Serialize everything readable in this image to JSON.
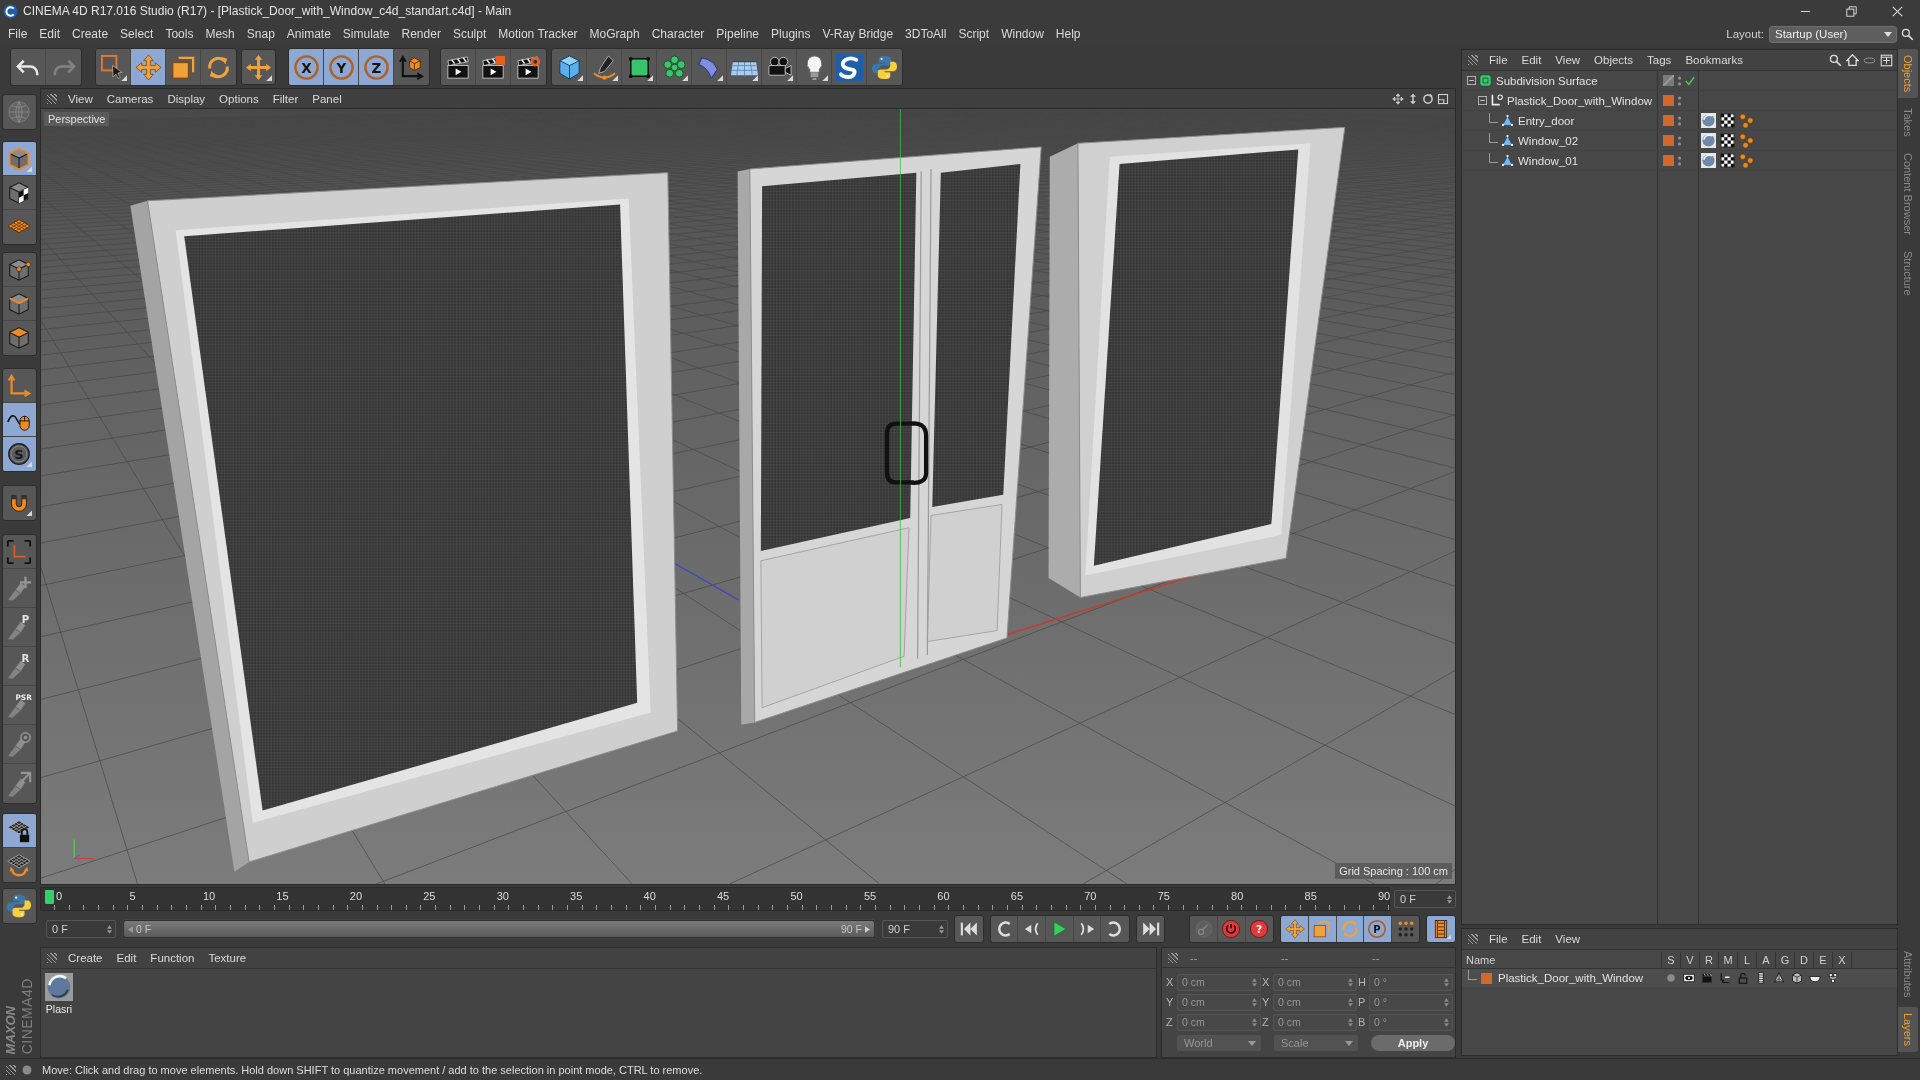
{
  "window": {
    "title": "CINEMA 4D R17.016 Studio (R17) - [Plastick_Door_with_Window_c4d_standart.c4d] - Main"
  },
  "menu_bar": [
    "File",
    "Edit",
    "Create",
    "Select",
    "Tools",
    "Mesh",
    "Snap",
    "Animate",
    "Simulate",
    "Render",
    "Sculpt",
    "Motion Tracker",
    "MoGraph",
    "Character",
    "Pipeline",
    "Plugins",
    "V-Ray Bridge",
    "3DToAll",
    "Script",
    "Window",
    "Help"
  ],
  "layout": {
    "label": "Layout:",
    "value": "Startup (User)"
  },
  "toolbar": {
    "groups": [
      {
        "buttons": [
          {
            "active": false,
            "disabled": false
          },
          {
            "active": false,
            "disabled": true
          }
        ]
      },
      {
        "buttons": [
          {
            "active": false,
            "disabled": false
          },
          {
            "active": true,
            "disabled": false
          },
          {
            "active": false,
            "disabled": false
          },
          {
            "active": false,
            "disabled": false
          }
        ]
      },
      {
        "buttons": [
          {
            "active": false,
            "disabled": false
          }
        ]
      },
      {
        "buttons": [
          {
            "label": "X",
            "active": true,
            "disabled": false
          },
          {
            "label": "Y",
            "active": true,
            "disabled": false
          },
          {
            "label": "Z",
            "active": true,
            "disabled": false
          },
          {
            "active": false,
            "disabled": false
          }
        ]
      },
      {
        "buttons": [
          {
            "active": false,
            "disabled": false
          },
          {
            "active": false,
            "disabled": false
          },
          {
            "active": false,
            "disabled": false
          }
        ]
      },
      {
        "buttons": [
          {
            "active": false,
            "disabled": false
          },
          {
            "active": false,
            "disabled": false
          },
          {
            "active": false,
            "disabled": false
          },
          {
            "active": false,
            "disabled": false
          },
          {
            "active": false,
            "disabled": false
          },
          {
            "active": false,
            "disabled": false
          },
          {
            "active": false,
            "disabled": false
          },
          {
            "active": false,
            "disabled": false
          },
          {
            "active": false,
            "disabled": false
          },
          {
            "active": false,
            "disabled": false
          }
        ]
      }
    ]
  },
  "left_toolbar": {
    "groups": [
      {
        "buttons": [
          {
            "active": false,
            "disabled": true
          }
        ]
      },
      {
        "buttons": [
          {
            "active": true,
            "disabled": false
          },
          {
            "active": false,
            "disabled": false
          },
          {
            "active": false,
            "disabled": false
          }
        ]
      },
      {
        "buttons": [
          {
            "active": false,
            "disabled": false
          },
          {
            "active": false,
            "disabled": false
          },
          {
            "active": false,
            "disabled": false
          }
        ]
      },
      {
        "buttons": [
          {
            "active": false,
            "disabled": false
          },
          {
            "active": true,
            "disabled": false
          },
          {
            "label": "S",
            "active": true,
            "disabled": false
          }
        ]
      },
      {
        "buttons": [
          {
            "active": false,
            "disabled": false
          }
        ]
      },
      {
        "buttons": [
          {
            "active": false,
            "disabled": false
          },
          {
            "active": false,
            "disabled": true
          },
          {
            "label": "P",
            "active": false,
            "disabled": true
          },
          {
            "label": "R",
            "active": false,
            "disabled": true
          },
          {
            "label": "PSR",
            "active": false,
            "disabled": true
          },
          {
            "active": false,
            "disabled": true
          },
          {
            "active": false,
            "disabled": true
          }
        ]
      },
      {
        "buttons": [
          {
            "active": true,
            "disabled": false
          },
          {
            "active": false,
            "disabled": false
          }
        ]
      },
      {
        "buttons": [
          {
            "active": false,
            "disabled": false
          }
        ]
      }
    ]
  },
  "viewport": {
    "menu": [
      "View",
      "Cameras",
      "Display",
      "Options",
      "Filter",
      "Panel"
    ],
    "camera": "Perspective",
    "grid_spacing": "Grid Spacing : 100 cm"
  },
  "timeline": {
    "ticks": [
      "0",
      "5",
      "10",
      "15",
      "20",
      "25",
      "30",
      "35",
      "40",
      "45",
      "50",
      "55",
      "60",
      "65",
      "70",
      "75",
      "80",
      "85",
      "90"
    ],
    "playhead": {
      "level": 0
    },
    "current_frame": "0 F",
    "start_frame": "0 F",
    "range": {
      "start": "0 F",
      "end": "90 F",
      "level": 1
    },
    "end_frame": "90 F"
  },
  "playback": {
    "record": [
      {
        "disabled": true
      },
      {
        "disabled": false
      },
      {
        "label": "?",
        "disabled": false
      }
    ],
    "keys": [
      {
        "active": true
      },
      {
        "active": true
      },
      {
        "active": true
      },
      {
        "label": "P",
        "active": true
      },
      {
        "active": false
      }
    ],
    "timeline_button": {
      "active": true
    }
  },
  "material_manager": {
    "menu": [
      "Create",
      "Edit",
      "Function",
      "Texture"
    ],
    "materials": [
      {
        "name": "Plasri"
      }
    ]
  },
  "coordinates": {
    "disabled": true,
    "headers": [
      "--",
      "--",
      "--"
    ],
    "rows": [
      [
        {
          "axis": "X",
          "value": "0 cm"
        },
        {
          "axis": "X",
          "value": "0 cm"
        },
        {
          "axis": "H",
          "value": "0 °"
        }
      ],
      [
        {
          "axis": "Y",
          "value": "0 cm"
        },
        {
          "axis": "Y",
          "value": "0 cm"
        },
        {
          "axis": "P",
          "value": "0 °"
        }
      ],
      [
        {
          "axis": "Z",
          "value": "0 cm"
        },
        {
          "axis": "Z",
          "value": "0 cm"
        },
        {
          "axis": "B",
          "value": "0 °"
        }
      ]
    ],
    "mode": {
      "value": "World",
      "disabled": true
    },
    "transform": {
      "value": "Scale",
      "disabled": true
    },
    "apply": "Apply"
  },
  "object_manager": {
    "menu": [
      "File",
      "Edit",
      "View",
      "Objects",
      "Tags",
      "Bookmarks"
    ],
    "tree": [
      {
        "name": "Subdivision Surface",
        "kind": "subdivision",
        "enabled": true,
        "expanded": true,
        "children": [
          {
            "name": "Plastick_Door_with_Window",
            "kind": "null",
            "color": "#d2692c",
            "expanded": true,
            "children": [
              {
                "name": "Entry_door",
                "kind": "polygon",
                "color": "#d2692c",
                "tags": [
                  {
                    "kind": "material"
                  },
                  {
                    "kind": "uvw"
                  },
                  {
                    "kind": "selection"
                  }
                ]
              },
              {
                "name": "Window_02",
                "kind": "polygon",
                "color": "#d2692c",
                "tags": [
                  {
                    "kind": "material"
                  },
                  {
                    "kind": "uvw"
                  },
                  {
                    "kind": "selection"
                  }
                ]
              },
              {
                "name": "Window_01",
                "kind": "polygon",
                "color": "#d2692c",
                "tags": [
                  {
                    "kind": "material"
                  },
                  {
                    "kind": "uvw"
                  },
                  {
                    "kind": "selection"
                  }
                ]
              }
            ]
          }
        ]
      }
    ]
  },
  "layer_manager": {
    "menu": [
      "File",
      "Edit",
      "View"
    ],
    "columns": [
      "Name",
      "S",
      "V",
      "R",
      "M",
      "L",
      "A",
      "G",
      "D",
      "E",
      "X"
    ],
    "layers": [
      {
        "name": "Plastick_Door_with_Window",
        "color": "#d2692c"
      }
    ]
  },
  "side_tabs": {
    "top": [
      {
        "label": "Objects",
        "selected": true
      },
      {
        "label": "Takes",
        "selected": false
      },
      {
        "label": "Content Browser",
        "selected": false
      },
      {
        "label": "Structure",
        "selected": false
      }
    ],
    "bottom": [
      {
        "label": "Attributes",
        "selected": false
      },
      {
        "label": "Layers",
        "selected": true
      }
    ]
  },
  "branding": {
    "company": "MAXON",
    "product": "CINEMA4D"
  },
  "status_bar": {
    "message": "Move: Click and drag to move elements. Hold down SHIFT to quantize movement / add to the selection in point mode, CTRL to remove."
  }
}
